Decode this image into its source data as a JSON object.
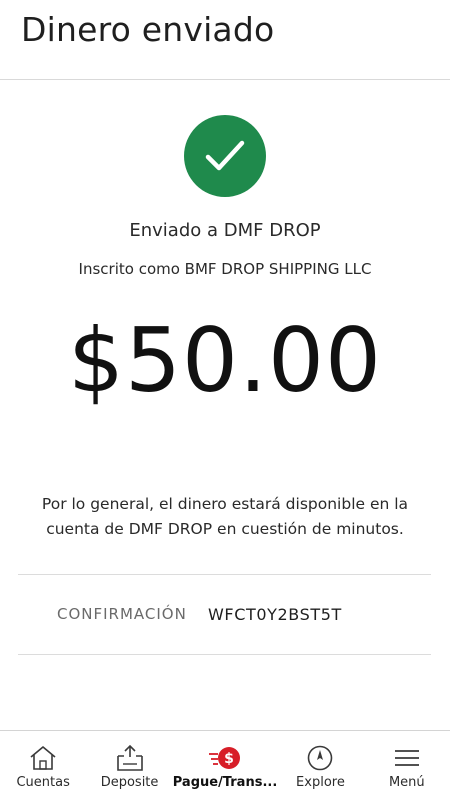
{
  "header": {
    "title": "Dinero enviado"
  },
  "confirmation_screen": {
    "sent_to": "Enviado a DMF DROP",
    "enrolled_as": "Inscrito como BMF DROP SHIPPING LLC",
    "amount": "$50.00",
    "info": "Por lo general, el dinero estará disponible en la cuenta de DMF DROP en cuestión de minutos.",
    "confirmation_label": "CONFIRMACIÓN",
    "confirmation_value": "WFCT0Y2BST5T",
    "success_icon": "check-circle-icon"
  },
  "tabbar": {
    "tabs": [
      {
        "label": "Cuentas",
        "icon": "home-icon"
      },
      {
        "label": "Deposite",
        "icon": "deposit-icon"
      },
      {
        "label": "Pague/Trans...",
        "icon": "pay-transfer-icon",
        "active": true
      },
      {
        "label": "Explore",
        "icon": "compass-icon"
      },
      {
        "label": "Menú",
        "icon": "hamburger-menu-icon"
      }
    ]
  },
  "colors": {
    "success_green": "#1f8a4c",
    "active_tab_red": "#d71e28",
    "divider": "#dcdcdc"
  }
}
